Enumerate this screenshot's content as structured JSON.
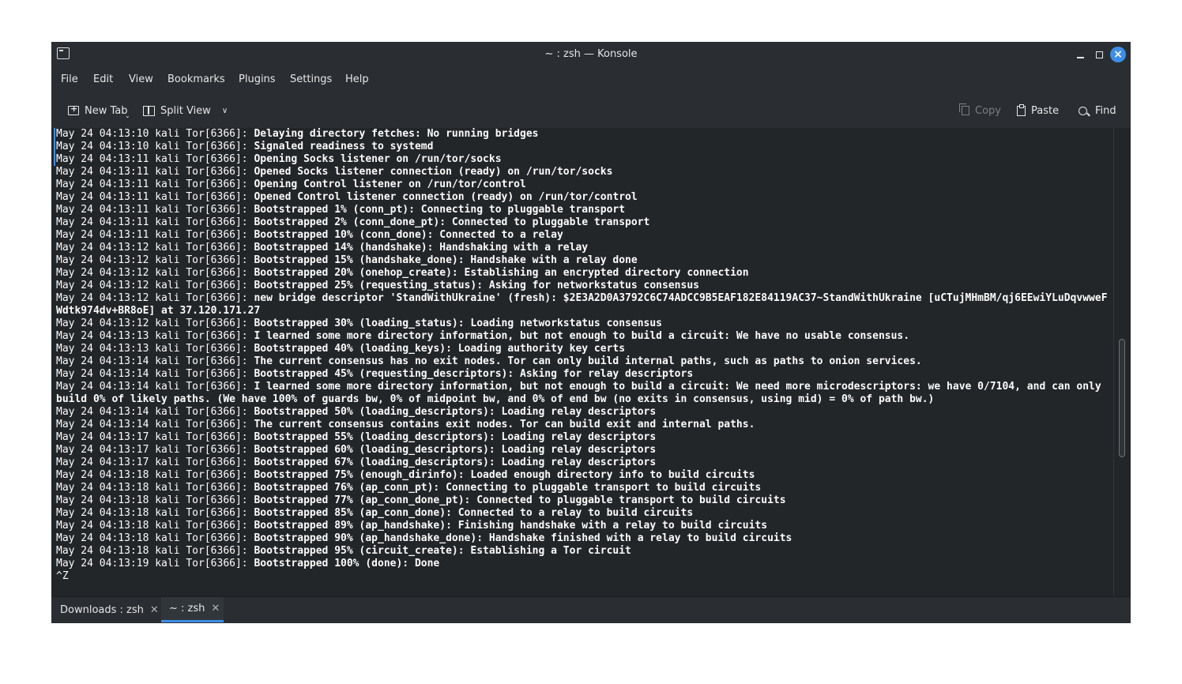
{
  "window": {
    "title": "~ : zsh — Konsole"
  },
  "menu": [
    "File",
    "Edit",
    "View",
    "Bookmarks",
    "Plugins",
    "Settings",
    "Help"
  ],
  "toolbar": {
    "new_tab": "New Tab",
    "split_view": "Split View",
    "copy": "Copy",
    "paste": "Paste",
    "find": "Find"
  },
  "terminal": {
    "lines": [
      {
        "prefix": "May 24 04:13:10 kali Tor[6366]: ",
        "msg": "Delaying directory fetches: No running bridges"
      },
      {
        "prefix": "May 24 04:13:10 kali Tor[6366]: ",
        "msg": "Signaled readiness to systemd"
      },
      {
        "prefix": "May 24 04:13:11 kali Tor[6366]: ",
        "msg": "Opening Socks listener on /run/tor/socks"
      },
      {
        "prefix": "May 24 04:13:11 kali Tor[6366]: ",
        "msg": "Opened Socks listener connection (ready) on /run/tor/socks"
      },
      {
        "prefix": "May 24 04:13:11 kali Tor[6366]: ",
        "msg": "Opening Control listener on /run/tor/control"
      },
      {
        "prefix": "May 24 04:13:11 kali Tor[6366]: ",
        "msg": "Opened Control listener connection (ready) on /run/tor/control"
      },
      {
        "prefix": "May 24 04:13:11 kali Tor[6366]: ",
        "msg": "Bootstrapped 1% (conn_pt): Connecting to pluggable transport"
      },
      {
        "prefix": "May 24 04:13:11 kali Tor[6366]: ",
        "msg": "Bootstrapped 2% (conn_done_pt): Connected to pluggable transport"
      },
      {
        "prefix": "May 24 04:13:11 kali Tor[6366]: ",
        "msg": "Bootstrapped 10% (conn_done): Connected to a relay"
      },
      {
        "prefix": "May 24 04:13:12 kali Tor[6366]: ",
        "msg": "Bootstrapped 14% (handshake): Handshaking with a relay"
      },
      {
        "prefix": "May 24 04:13:12 kali Tor[6366]: ",
        "msg": "Bootstrapped 15% (handshake_done): Handshake with a relay done"
      },
      {
        "prefix": "May 24 04:13:12 kali Tor[6366]: ",
        "msg": "Bootstrapped 20% (onehop_create): Establishing an encrypted directory connection"
      },
      {
        "prefix": "May 24 04:13:12 kali Tor[6366]: ",
        "msg": "Bootstrapped 25% (requesting_status): Asking for networkstatus consensus"
      },
      {
        "prefix": "May 24 04:13:12 kali Tor[6366]: ",
        "msg": "new bridge descriptor 'StandWithUkraine' (fresh): $2E3A2D0A3792C6C74ADCC9B5EAF182E84119AC37~StandWithUkraine [uCTujMHmBM/qj6EEwiYLuDqvwweFWdtk974dv+BR8oE] at 37.120.171.27"
      },
      {
        "prefix": "May 24 04:13:12 kali Tor[6366]: ",
        "msg": "Bootstrapped 30% (loading_status): Loading networkstatus consensus"
      },
      {
        "prefix": "May 24 04:13:13 kali Tor[6366]: ",
        "msg": "I learned some more directory information, but not enough to build a circuit: We have no usable consensus."
      },
      {
        "prefix": "May 24 04:13:13 kali Tor[6366]: ",
        "msg": "Bootstrapped 40% (loading_keys): Loading authority key certs"
      },
      {
        "prefix": "May 24 04:13:14 kali Tor[6366]: ",
        "msg": "The current consensus has no exit nodes. Tor can only build internal paths, such as paths to onion services."
      },
      {
        "prefix": "May 24 04:13:14 kali Tor[6366]: ",
        "msg": "Bootstrapped 45% (requesting_descriptors): Asking for relay descriptors"
      },
      {
        "prefix": "May 24 04:13:14 kali Tor[6366]: ",
        "msg": "I learned some more directory information, but not enough to build a circuit: We need more microdescriptors: we have 0/7104, and can only build 0% of likely paths. (We have 100% of guards bw, 0% of midpoint bw, and 0% of end bw (no exits in consensus, using mid) = 0% of path bw.)"
      },
      {
        "prefix": "May 24 04:13:14 kali Tor[6366]: ",
        "msg": "Bootstrapped 50% (loading_descriptors): Loading relay descriptors"
      },
      {
        "prefix": "May 24 04:13:14 kali Tor[6366]: ",
        "msg": "The current consensus contains exit nodes. Tor can build exit and internal paths."
      },
      {
        "prefix": "May 24 04:13:17 kali Tor[6366]: ",
        "msg": "Bootstrapped 55% (loading_descriptors): Loading relay descriptors"
      },
      {
        "prefix": "May 24 04:13:17 kali Tor[6366]: ",
        "msg": "Bootstrapped 60% (loading_descriptors): Loading relay descriptors"
      },
      {
        "prefix": "May 24 04:13:17 kali Tor[6366]: ",
        "msg": "Bootstrapped 67% (loading_descriptors): Loading relay descriptors"
      },
      {
        "prefix": "May 24 04:13:18 kali Tor[6366]: ",
        "msg": "Bootstrapped 75% (enough_dirinfo): Loaded enough directory info to build circuits"
      },
      {
        "prefix": "May 24 04:13:18 kali Tor[6366]: ",
        "msg": "Bootstrapped 76% (ap_conn_pt): Connecting to pluggable transport to build circuits"
      },
      {
        "prefix": "May 24 04:13:18 kali Tor[6366]: ",
        "msg": "Bootstrapped 77% (ap_conn_done_pt): Connected to pluggable transport to build circuits"
      },
      {
        "prefix": "May 24 04:13:18 kali Tor[6366]: ",
        "msg": "Bootstrapped 85% (ap_conn_done): Connected to a relay to build circuits"
      },
      {
        "prefix": "May 24 04:13:18 kali Tor[6366]: ",
        "msg": "Bootstrapped 89% (ap_handshake): Finishing handshake with a relay to build circuits"
      },
      {
        "prefix": "May 24 04:13:18 kali Tor[6366]: ",
        "msg": "Bootstrapped 90% (ap_handshake_done): Handshake finished with a relay to build circuits"
      },
      {
        "prefix": "May 24 04:13:18 kali Tor[6366]: ",
        "msg": "Bootstrapped 95% (circuit_create): Establishing a Tor circuit"
      },
      {
        "prefix": "May 24 04:13:19 kali Tor[6366]: ",
        "msg": "Bootstrapped 100% (done): Done"
      },
      {
        "prefix": "^Z",
        "msg": ""
      }
    ]
  },
  "tabs": [
    {
      "label": "Downloads : zsh",
      "active": false
    },
    {
      "label": "~ : zsh",
      "active": true
    }
  ],
  "colors": {
    "accent": "#3d8ee8",
    "window_bg": "#2a2e32",
    "terminal_bg": "#232629",
    "text": "#fcfcfc"
  },
  "icons": {
    "app": "terminal-icon",
    "new_tab": "new-tab-icon",
    "split_view": "split-view-icon",
    "copy": "copy-icon",
    "paste": "paste-icon",
    "find": "search-icon"
  }
}
